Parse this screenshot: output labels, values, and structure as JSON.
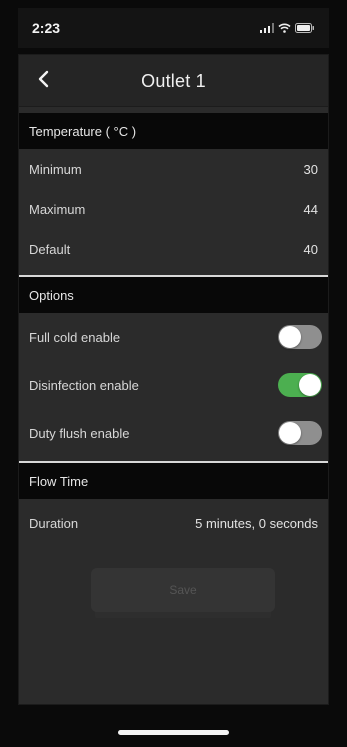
{
  "status_bar": {
    "time": "2:23"
  },
  "header": {
    "title": "Outlet 1",
    "back_icon": "chevron-left-icon"
  },
  "temperature": {
    "section_title": "Temperature ( °C )",
    "rows": [
      {
        "label": "Minimum",
        "value": "30"
      },
      {
        "label": "Maximum",
        "value": "44"
      },
      {
        "label": "Default",
        "value": "40"
      }
    ]
  },
  "options": {
    "section_title": "Options",
    "items": [
      {
        "label": "Full cold enable",
        "enabled": false
      },
      {
        "label": "Disinfection enable",
        "enabled": true
      },
      {
        "label": "Duty flush enable",
        "enabled": false
      }
    ]
  },
  "flow_time": {
    "section_title": "Flow Time",
    "label": "Duration",
    "value": "5 minutes, 0 seconds"
  },
  "actions": {
    "save_label": "Save",
    "save_enabled": false
  },
  "colors": {
    "toggle_on": "#4caf50",
    "toggle_off": "#8f8f8f",
    "background": "#2b2b2b",
    "section_header": "#080808"
  }
}
